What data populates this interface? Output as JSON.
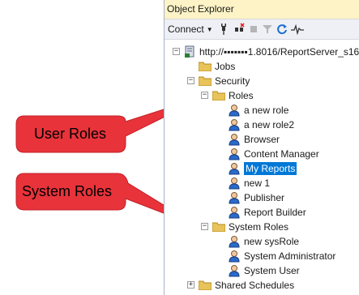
{
  "panel": {
    "title": "Object Explorer",
    "toolbar": {
      "connect_label": "Connect"
    }
  },
  "tree": {
    "server": "http://▪▪▪▪▪▪▪1.8016/ReportServer_s16",
    "jobs": "Jobs",
    "security": "Security",
    "roles": "Roles",
    "role_items": [
      "a new role",
      "a new role2",
      "Browser",
      "Content Manager",
      "My Reports",
      "new 1",
      "Publisher",
      "Report Builder"
    ],
    "system_roles": "System Roles",
    "system_role_items": [
      "new sysRole",
      "System Administrator",
      "System User"
    ],
    "shared_schedules": "Shared Schedules"
  },
  "callouts": {
    "user_roles": "User Roles",
    "system_roles": "System Roles"
  },
  "colors": {
    "callout_fill": "#e8333b",
    "selection": "#0078d7",
    "folder": "#e8c35a",
    "title_bar": "#fdf3c6"
  }
}
